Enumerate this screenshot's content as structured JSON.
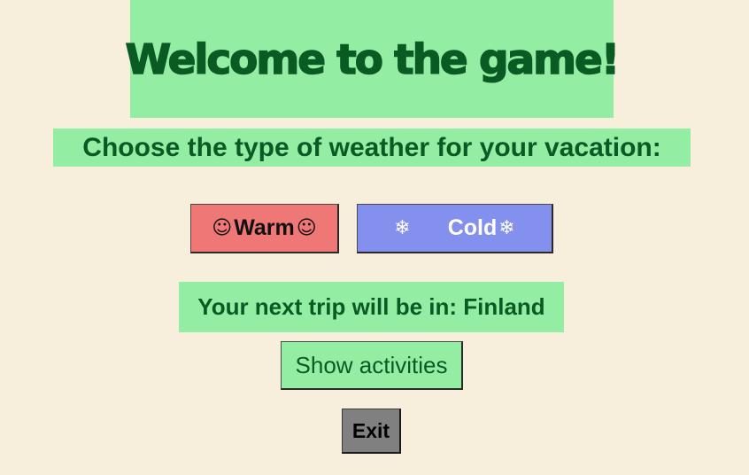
{
  "title": "Welcome to the game!",
  "prompt": "Choose the type of weather for your vacation:",
  "buttons": {
    "warm": {
      "label": "Warm",
      "icon_left": "☺",
      "icon_right": "☺",
      "icon_name": "smiling-sun-icon"
    },
    "cold": {
      "label": "Cold",
      "icon_left": "❄",
      "icon_right": "❄",
      "icon_name": "snowflake-icon"
    },
    "activities": {
      "label": "Show activities"
    },
    "exit": {
      "label": "Exit"
    }
  },
  "result": {
    "text": "Your next trip will be in: Finland"
  },
  "colors": {
    "background": "#f7eedb",
    "panel_green": "#93eea4",
    "text_dark_green": "#0a5a23",
    "warm_button": "#ef7876",
    "cold_button": "#8390ee",
    "exit_button": "#808080"
  }
}
